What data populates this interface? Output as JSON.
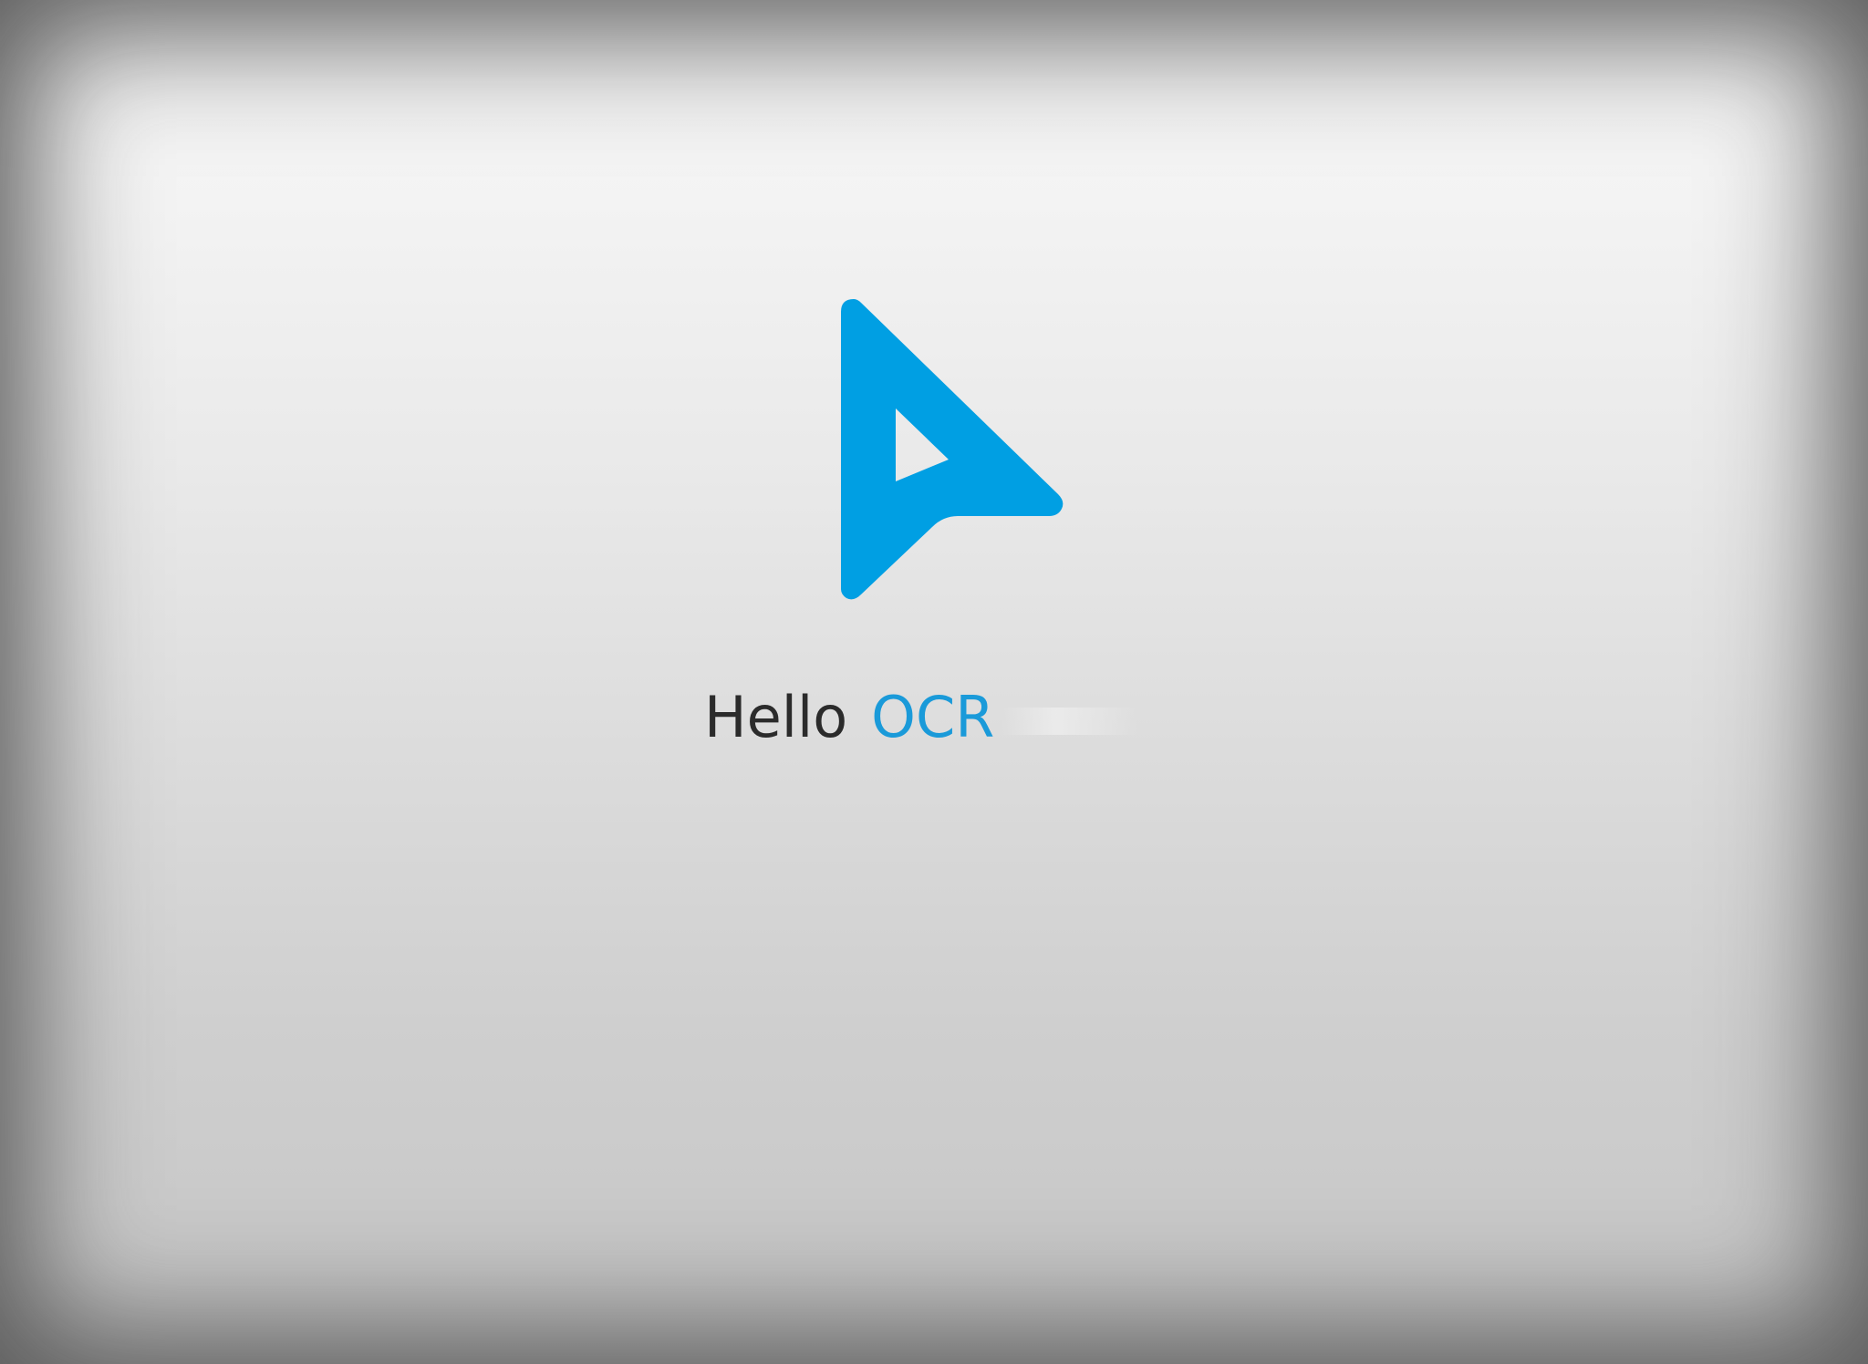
{
  "splash": {
    "logo_icon": "arrow-cursor-logo-icon",
    "brand_color": "#009FE3",
    "text_color": "#2B2B2B",
    "title_primary": "Hello",
    "title_accent": "OCR"
  }
}
